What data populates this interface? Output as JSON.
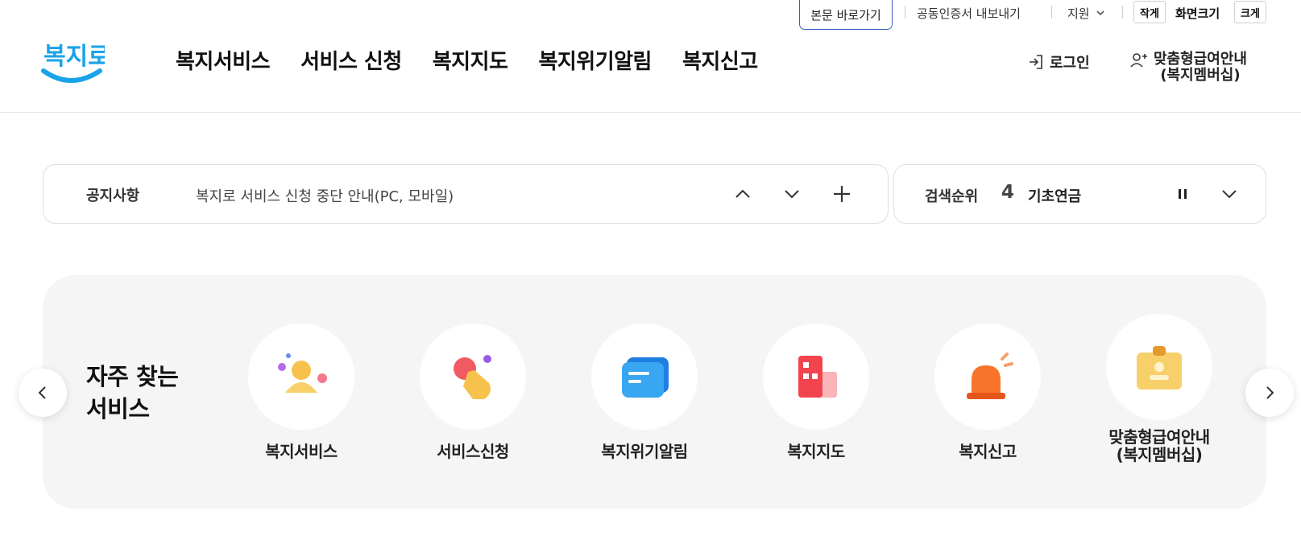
{
  "utility": {
    "skip_link": "본문 바로가기",
    "cert_export": "공동인증서 내보내기",
    "support": "지원",
    "font_small": "작게",
    "font_size_label": "화면크기",
    "font_large": "크게"
  },
  "logo": {
    "text": "복지로"
  },
  "nav": {
    "items": [
      "복지서비스",
      "서비스 신청",
      "복지지도",
      "복지위기알림",
      "복지신고"
    ]
  },
  "header_actions": {
    "login": "로그인",
    "member_line1": "맞춤형급여안내",
    "member_line2": "(복지멤버십)"
  },
  "notice": {
    "label": "공지사항",
    "text": "복지로 서비스 신청 중단 안내(PC, 모바일)"
  },
  "search_rank": {
    "label": "검색순위",
    "rank": "4",
    "term": "기초연금"
  },
  "frequent": {
    "title_line1": "자주 찾는",
    "title_line2": "서비스",
    "items": [
      {
        "label": "복지서비스",
        "icon": "person-icon"
      },
      {
        "label": "서비스신청",
        "icon": "hand-click-icon"
      },
      {
        "label": "복지위기알림",
        "icon": "message-icon"
      },
      {
        "label": "복지지도",
        "icon": "building-icon"
      },
      {
        "label": "복지신고",
        "icon": "siren-icon"
      },
      {
        "label": "맞춤형급여안내\n(복지멤버십)",
        "icon": "id-card-icon"
      }
    ]
  },
  "colors": {
    "accent_border": "#3b5fc4",
    "logo_blue": "#1aa3e8",
    "panel_bg": "#f5f5f5"
  }
}
